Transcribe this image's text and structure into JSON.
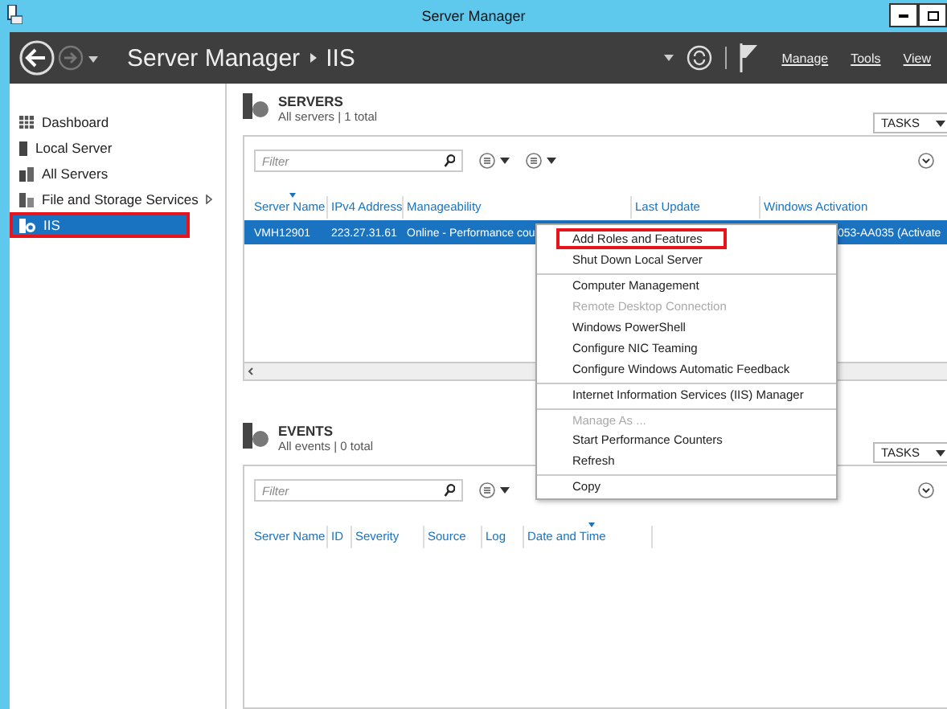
{
  "window": {
    "title": "Server Manager"
  },
  "header": {
    "breadcrumb": [
      "Server Manager",
      "IIS"
    ],
    "menu": [
      "Manage",
      "Tools",
      "View"
    ]
  },
  "sidebar": {
    "items": [
      {
        "label": "Dashboard",
        "kind": "dashboard",
        "selected": false,
        "expandable": false,
        "annotated": false
      },
      {
        "label": "Local Server",
        "kind": "server",
        "selected": false,
        "expandable": false,
        "annotated": false
      },
      {
        "label": "All Servers",
        "kind": "servers",
        "selected": false,
        "expandable": false,
        "annotated": false
      },
      {
        "label": "File and Storage Services",
        "kind": "storage",
        "selected": false,
        "expandable": true,
        "annotated": false
      },
      {
        "label": "IIS",
        "kind": "iis",
        "selected": true,
        "expandable": false,
        "annotated": true
      }
    ]
  },
  "servers": {
    "title": "SERVERS",
    "subtitle": "All servers | 1 total",
    "tasks": "TASKS",
    "filter_placeholder": "Filter",
    "columns": [
      {
        "label": "Server Name",
        "sorted": true
      },
      {
        "label": "IPv4 Address",
        "sorted": false
      },
      {
        "label": "Manageability",
        "sorted": false
      },
      {
        "label": "Last Update",
        "sorted": false
      },
      {
        "label": "Windows Activation",
        "sorted": false
      }
    ],
    "rows": [
      {
        "selected": true,
        "cells": [
          "VMH12901",
          "223.27.31.61",
          "Online - Performance cou",
          "",
          "053-AA035 (Activate"
        ]
      }
    ]
  },
  "events": {
    "title": "EVENTS",
    "subtitle": "All events | 0 total",
    "tasks": "TASKS",
    "filter_placeholder": "Filter",
    "columns": [
      {
        "label": "Server Name",
        "sorted": false
      },
      {
        "label": "ID",
        "sorted": false
      },
      {
        "label": "Severity",
        "sorted": false
      },
      {
        "label": "Source",
        "sorted": false
      },
      {
        "label": "Log",
        "sorted": false
      },
      {
        "label": "Date and Time",
        "sorted": true
      }
    ]
  },
  "context_menu": {
    "items": [
      {
        "label": "Add Roles and Features",
        "disabled": false,
        "separator_before": false,
        "annotated": true
      },
      {
        "label": "Shut Down Local Server",
        "disabled": false,
        "separator_before": false,
        "annotated": false
      },
      {
        "label": "Computer Management",
        "disabled": false,
        "separator_before": true,
        "annotated": false
      },
      {
        "label": "Remote Desktop Connection",
        "disabled": true,
        "separator_before": false,
        "annotated": false
      },
      {
        "label": "Windows PowerShell",
        "disabled": false,
        "separator_before": false,
        "annotated": false
      },
      {
        "label": "Configure NIC Teaming",
        "disabled": false,
        "separator_before": false,
        "annotated": false
      },
      {
        "label": "Configure Windows Automatic Feedback",
        "disabled": false,
        "separator_before": false,
        "annotated": false
      },
      {
        "label": "Internet Information Services (IIS) Manager",
        "disabled": false,
        "separator_before": true,
        "annotated": false
      },
      {
        "label": "Manage As ...",
        "disabled": true,
        "separator_before": true,
        "annotated": false
      },
      {
        "label": "Start Performance Counters",
        "disabled": false,
        "separator_before": false,
        "annotated": false
      },
      {
        "label": "Refresh",
        "disabled": false,
        "separator_before": false,
        "annotated": false
      },
      {
        "label": "Copy",
        "disabled": false,
        "separator_before": true,
        "annotated": false
      }
    ]
  }
}
